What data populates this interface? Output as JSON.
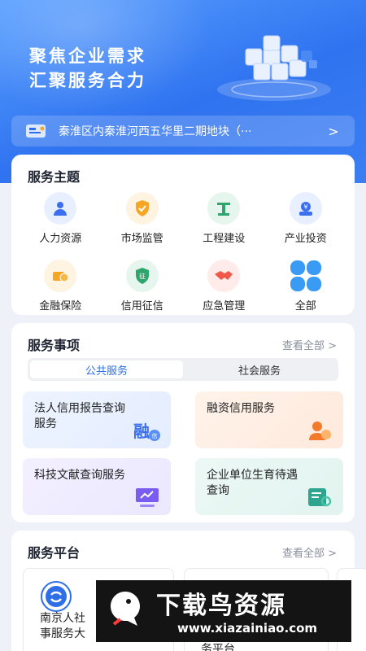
{
  "hero": {
    "title_line1": "聚焦企业需求",
    "title_line2": "汇聚服务合力"
  },
  "notice": {
    "text": "秦淮区内秦淮河西五华里二期地块（···",
    "arrow": ">"
  },
  "theme": {
    "title": "服务主题",
    "items": [
      {
        "label": "人力资源",
        "icon": "person-icon",
        "color": "#3b6ff0"
      },
      {
        "label": "市场监管",
        "icon": "shield-icon",
        "color": "#f5a623"
      },
      {
        "label": "工程建设",
        "icon": "crane-icon",
        "color": "#2ea56d"
      },
      {
        "label": "产业投资",
        "icon": "money-bag-icon",
        "color": "#3b6ff0"
      },
      {
        "label": "金融保险",
        "icon": "coins-icon",
        "color": "#f5a623"
      },
      {
        "label": "信用征信",
        "icon": "credit-badge-icon",
        "color": "#2ea56d"
      },
      {
        "label": "应急管理",
        "icon": "handshake-icon",
        "color": "#f0584a"
      },
      {
        "label": "全部",
        "icon": "grid-icon",
        "color": "#3a9bf5"
      }
    ]
  },
  "items": {
    "title": "服务事项",
    "more": "查看全部 >",
    "tabs": [
      "公共服务",
      "社会服务"
    ],
    "tiles": [
      {
        "text": "法人信用报告查询服务",
        "icon": "credit-report-icon"
      },
      {
        "text": "融资信用服务",
        "icon": "financing-icon"
      },
      {
        "text": "科技文献查询服务",
        "icon": "monitor-icon"
      },
      {
        "text": "企业单位生育待遇查询",
        "icon": "document-search-icon"
      }
    ]
  },
  "platform": {
    "title": "服务平台",
    "more": "查看全部 >",
    "cards": [
      {
        "text": "南京人社事服务大"
      },
      {
        "text": "务平台"
      }
    ]
  },
  "watermark": {
    "name": "下载鸟资源",
    "url": "www.xiazainiao.com"
  }
}
